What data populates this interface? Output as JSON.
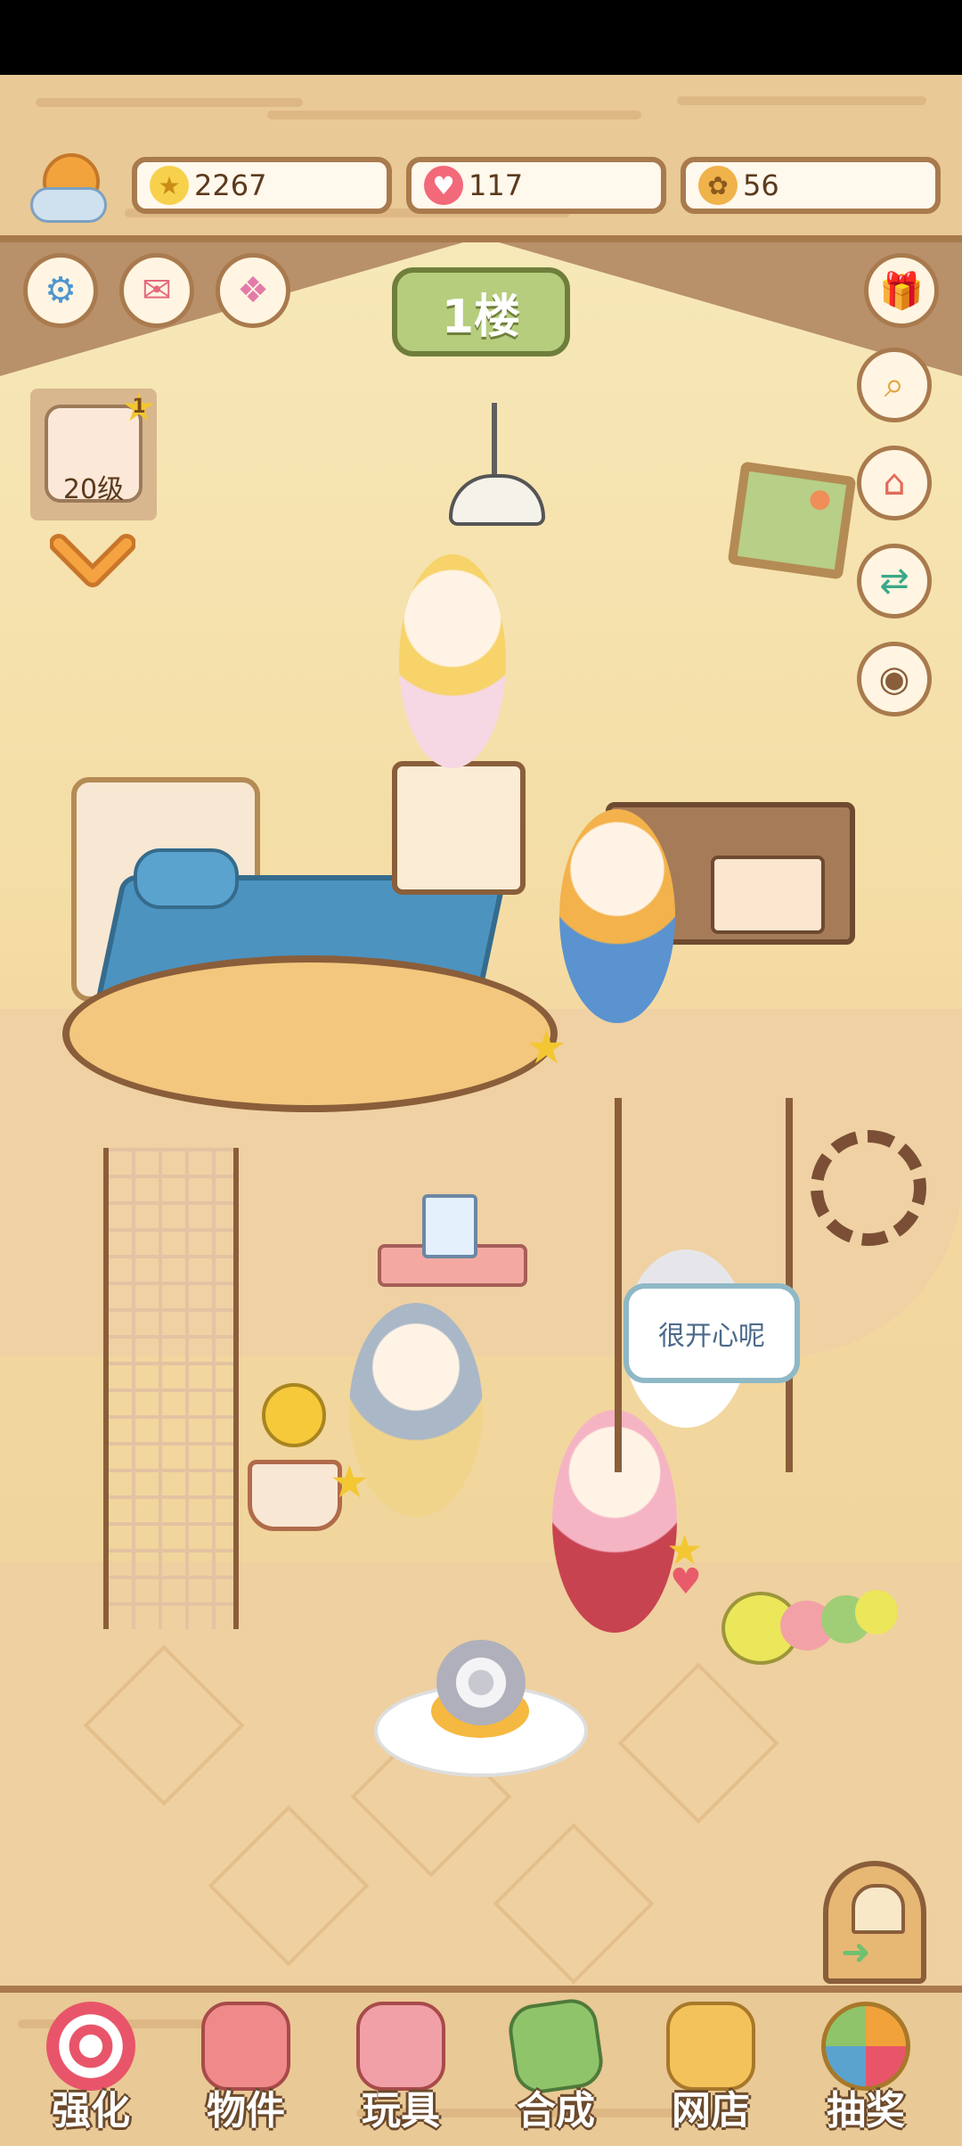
{
  "resources": {
    "stars": "2267",
    "hearts": "117",
    "paws": "56"
  },
  "floor_label": "1楼",
  "profile": {
    "level": "20级",
    "badge": "1"
  },
  "speech_bubble": "很开心呢",
  "nav": [
    {
      "label": "强化",
      "icon": "swirl-candy-icon",
      "color": "#e8556a"
    },
    {
      "label": "物件",
      "icon": "piano-icon",
      "color": "#f08a8a"
    },
    {
      "label": "玩具",
      "icon": "toy-house-icon",
      "color": "#f1a0a8"
    },
    {
      "label": "合成",
      "icon": "cards-icon",
      "color": "#8fc46a"
    },
    {
      "label": "网店",
      "icon": "shop-cart-icon",
      "color": "#f3c25a"
    },
    {
      "label": "抽奖",
      "icon": "lottery-wheel-icon",
      "color": "#f2a23a"
    }
  ],
  "colors": {
    "wood": "#e9c995",
    "wood_border": "#a97a4d",
    "wall": "#f7e8b8",
    "floor": "#efd1a4"
  }
}
